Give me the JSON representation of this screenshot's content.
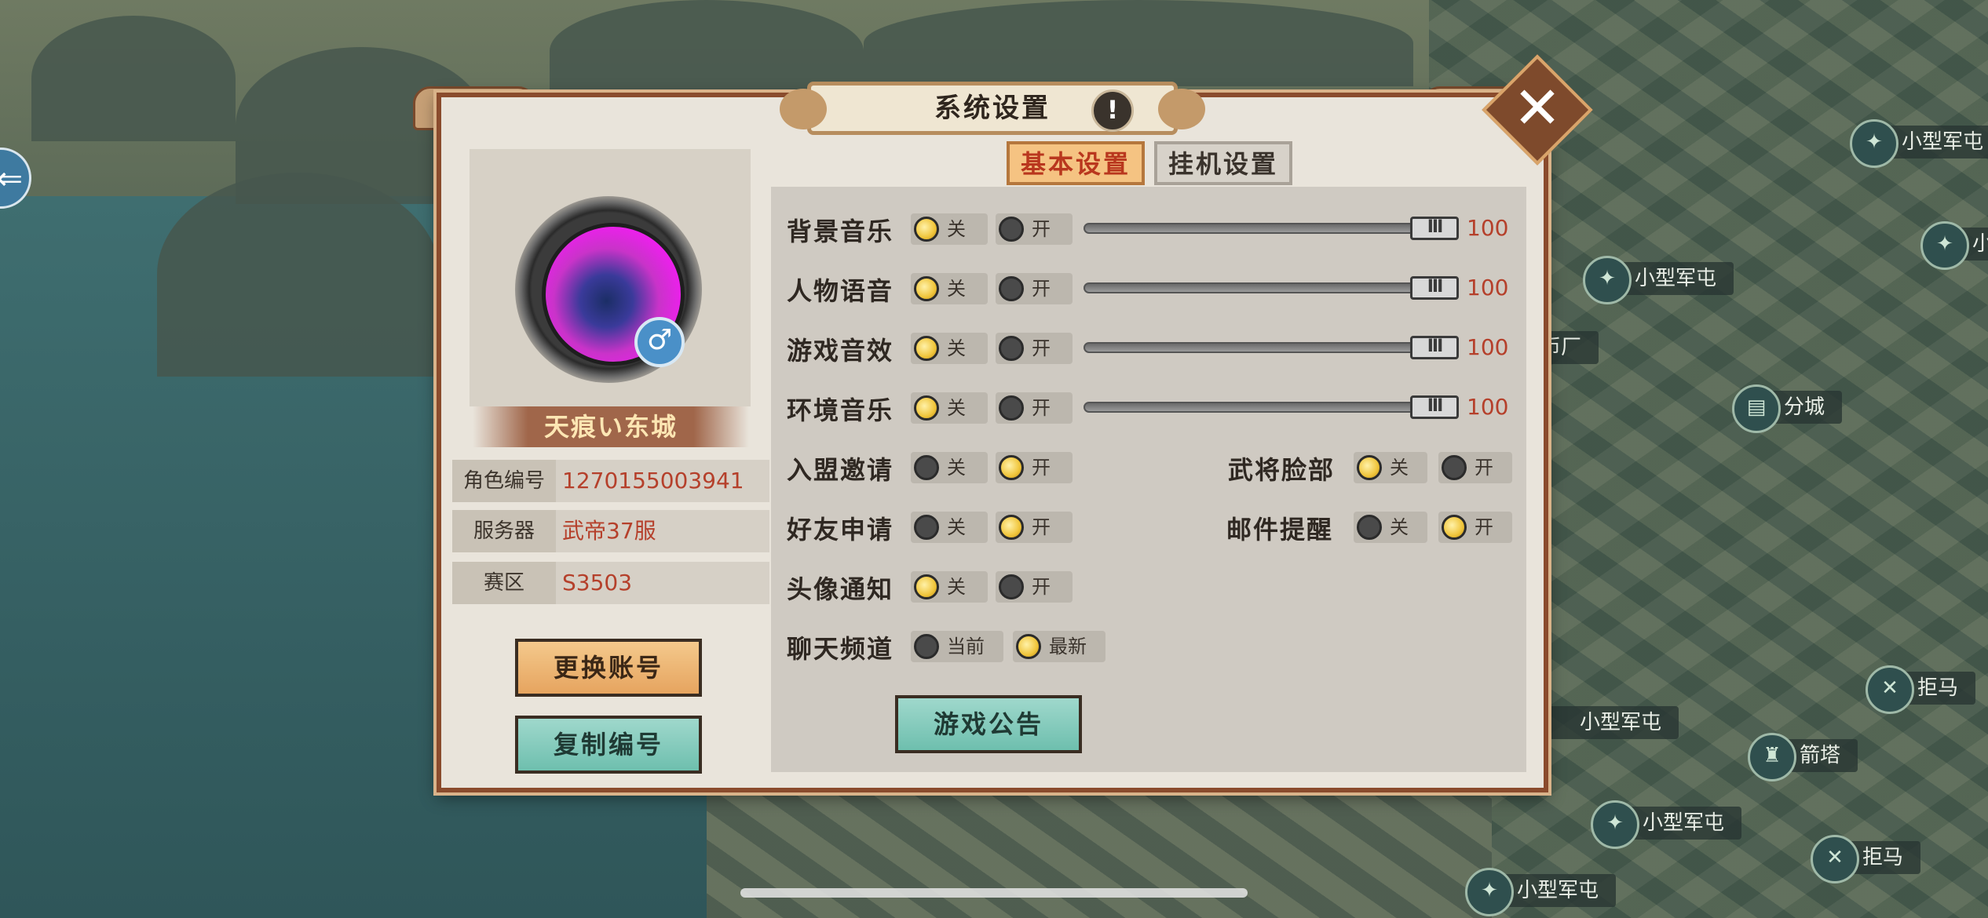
{
  "dialog": {
    "title": "系统设置",
    "info_icon": "!",
    "close_icon": "✕"
  },
  "tabs": [
    {
      "label": "基本设置",
      "active": true
    },
    {
      "label": "挂机设置",
      "active": false
    }
  ],
  "profile": {
    "name": "天痕い东城",
    "gender_icon": "♂",
    "rows": [
      {
        "label": "角色编号",
        "value": "1270155003941"
      },
      {
        "label": "服务器",
        "value": "武帝37服"
      },
      {
        "label": "赛区",
        "value": "S3503"
      }
    ],
    "buttons": {
      "switch_account": "更换账号",
      "copy_id": "复制编号"
    }
  },
  "audio": [
    {
      "label": "背景音乐",
      "off": "关",
      "on": "开",
      "selected": "关",
      "value": "100"
    },
    {
      "label": "人物语音",
      "off": "关",
      "on": "开",
      "selected": "关",
      "value": "100"
    },
    {
      "label": "游戏音效",
      "off": "关",
      "on": "开",
      "selected": "关",
      "value": "100"
    },
    {
      "label": "环境音乐",
      "off": "关",
      "on": "开",
      "selected": "关",
      "value": "100"
    }
  ],
  "options": {
    "alliance_invite": {
      "label": "入盟邀请",
      "off": "关",
      "on": "开",
      "selected": "开"
    },
    "general_face": {
      "label": "武将脸部",
      "off": "关",
      "on": "开",
      "selected": "关"
    },
    "friend_request": {
      "label": "好友申请",
      "off": "关",
      "on": "开",
      "selected": "开"
    },
    "mail_reminder": {
      "label": "邮件提醒",
      "off": "关",
      "on": "开",
      "selected": "开"
    },
    "avatar_notice": {
      "label": "头像通知",
      "off": "关",
      "on": "开",
      "selected": "关"
    },
    "chat_channel": {
      "label": "聊天频道",
      "current": "当前",
      "latest": "最新",
      "selected": "最新"
    }
  },
  "notice_button": "游戏公告",
  "map_labels": [
    "小型军屯",
    "小型军屯",
    "币厂",
    "分城",
    "拒马",
    "小型军屯",
    "箭塔",
    "小型军屯",
    "拒马",
    "小型军屯",
    "小"
  ],
  "colors": {
    "accent": "#b5402b",
    "frame": "#8a4b2d",
    "panel": "#cfcac2"
  }
}
